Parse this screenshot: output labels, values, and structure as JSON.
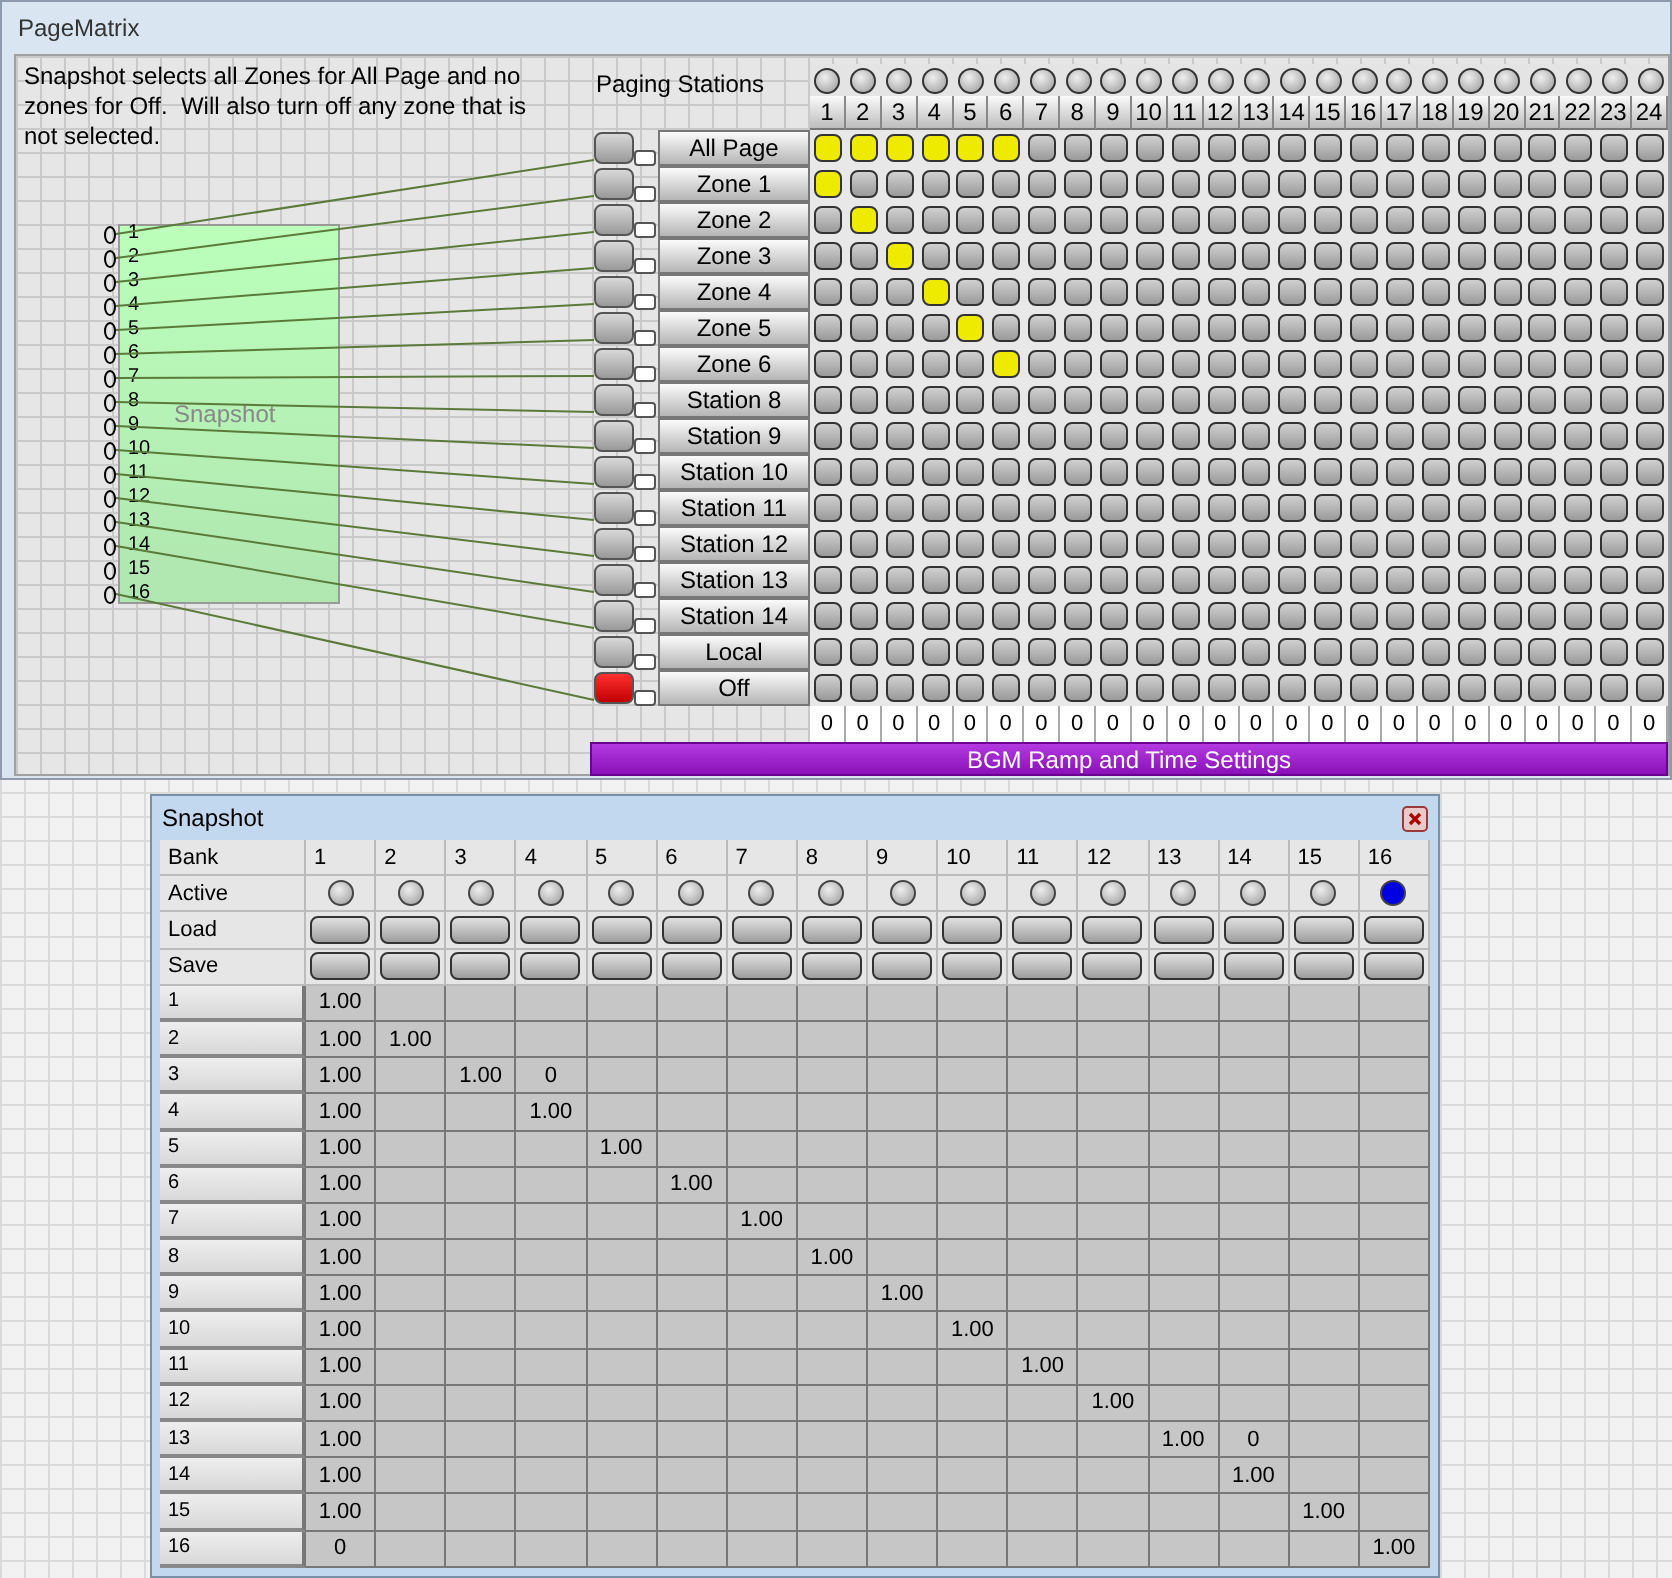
{
  "window": {
    "title": "PageMatrix"
  },
  "description": "Snapshot selects all Zones for All Page and no zones for Off.  Will also turn off any zone that is not selected.",
  "snapshot_block": {
    "label": "Snapshot",
    "pins": [
      {
        "label": "1",
        "connected": true
      },
      {
        "label": "2",
        "connected": true
      },
      {
        "label": "3",
        "connected": true
      },
      {
        "label": "4",
        "connected": true
      },
      {
        "label": "5",
        "connected": true
      },
      {
        "label": "6",
        "connected": true
      },
      {
        "label": "7",
        "connected": true
      },
      {
        "label": "8",
        "connected": true
      },
      {
        "label": "9",
        "connected": true
      },
      {
        "label": "10",
        "connected": true
      },
      {
        "label": "11",
        "connected": true
      },
      {
        "label": "12",
        "connected": true
      },
      {
        "label": "13",
        "connected": true
      },
      {
        "label": "14",
        "connected": true
      },
      {
        "label": "15",
        "connected": false
      },
      {
        "label": "16",
        "connected": true
      }
    ]
  },
  "matrix": {
    "title": "Paging Stations",
    "columns": [
      {
        "label": "1",
        "lit": false,
        "value": "0"
      },
      {
        "label": "2",
        "lit": false,
        "value": "0"
      },
      {
        "label": "3",
        "lit": false,
        "value": "0"
      },
      {
        "label": "4",
        "lit": false,
        "value": "0"
      },
      {
        "label": "5",
        "lit": false,
        "value": "0"
      },
      {
        "label": "6",
        "lit": false,
        "value": "0"
      },
      {
        "label": "7",
        "lit": false,
        "value": "0"
      },
      {
        "label": "8",
        "lit": false,
        "value": "0"
      },
      {
        "label": "9",
        "lit": false,
        "value": "0"
      },
      {
        "label": "10",
        "lit": false,
        "value": "0"
      },
      {
        "label": "11",
        "lit": false,
        "value": "0"
      },
      {
        "label": "12",
        "lit": false,
        "value": "0"
      },
      {
        "label": "13",
        "lit": false,
        "value": "0"
      },
      {
        "label": "14",
        "lit": false,
        "value": "0"
      },
      {
        "label": "15",
        "lit": false,
        "value": "0"
      },
      {
        "label": "16",
        "lit": false,
        "value": "0"
      },
      {
        "label": "17",
        "lit": false,
        "value": "0"
      },
      {
        "label": "18",
        "lit": false,
        "value": "0"
      },
      {
        "label": "19",
        "lit": false,
        "value": "0"
      },
      {
        "label": "20",
        "lit": false,
        "value": "0"
      },
      {
        "label": "21",
        "lit": false,
        "value": "0"
      },
      {
        "label": "22",
        "lit": false,
        "value": "0"
      },
      {
        "label": "23",
        "lit": false,
        "value": "0"
      },
      {
        "label": "24",
        "lit": false,
        "value": "0"
      }
    ],
    "stations": [
      {
        "label": "All Page",
        "active": false,
        "crosspoints": [
          true,
          true,
          true,
          true,
          true,
          true,
          false,
          false,
          false,
          false,
          false,
          false,
          false,
          false,
          false,
          false,
          false,
          false,
          false,
          false,
          false,
          false,
          false,
          false
        ]
      },
      {
        "label": "Zone 1",
        "active": false,
        "crosspoints": [
          true,
          false,
          false,
          false,
          false,
          false,
          false,
          false,
          false,
          false,
          false,
          false,
          false,
          false,
          false,
          false,
          false,
          false,
          false,
          false,
          false,
          false,
          false,
          false
        ]
      },
      {
        "label": "Zone 2",
        "active": false,
        "crosspoints": [
          false,
          true,
          false,
          false,
          false,
          false,
          false,
          false,
          false,
          false,
          false,
          false,
          false,
          false,
          false,
          false,
          false,
          false,
          false,
          false,
          false,
          false,
          false,
          false
        ]
      },
      {
        "label": "Zone 3",
        "active": false,
        "crosspoints": [
          false,
          false,
          true,
          false,
          false,
          false,
          false,
          false,
          false,
          false,
          false,
          false,
          false,
          false,
          false,
          false,
          false,
          false,
          false,
          false,
          false,
          false,
          false,
          false
        ]
      },
      {
        "label": "Zone 4",
        "active": false,
        "crosspoints": [
          false,
          false,
          false,
          true,
          false,
          false,
          false,
          false,
          false,
          false,
          false,
          false,
          false,
          false,
          false,
          false,
          false,
          false,
          false,
          false,
          false,
          false,
          false,
          false
        ]
      },
      {
        "label": "Zone 5",
        "active": false,
        "crosspoints": [
          false,
          false,
          false,
          false,
          true,
          false,
          false,
          false,
          false,
          false,
          false,
          false,
          false,
          false,
          false,
          false,
          false,
          false,
          false,
          false,
          false,
          false,
          false,
          false
        ]
      },
      {
        "label": "Zone 6",
        "active": false,
        "crosspoints": [
          false,
          false,
          false,
          false,
          false,
          true,
          false,
          false,
          false,
          false,
          false,
          false,
          false,
          false,
          false,
          false,
          false,
          false,
          false,
          false,
          false,
          false,
          false,
          false
        ]
      },
      {
        "label": "Station 8",
        "active": false,
        "crosspoints": [
          false,
          false,
          false,
          false,
          false,
          false,
          false,
          false,
          false,
          false,
          false,
          false,
          false,
          false,
          false,
          false,
          false,
          false,
          false,
          false,
          false,
          false,
          false,
          false
        ]
      },
      {
        "label": "Station 9",
        "active": false,
        "crosspoints": [
          false,
          false,
          false,
          false,
          false,
          false,
          false,
          false,
          false,
          false,
          false,
          false,
          false,
          false,
          false,
          false,
          false,
          false,
          false,
          false,
          false,
          false,
          false,
          false
        ]
      },
      {
        "label": "Station 10",
        "active": false,
        "crosspoints": [
          false,
          false,
          false,
          false,
          false,
          false,
          false,
          false,
          false,
          false,
          false,
          false,
          false,
          false,
          false,
          false,
          false,
          false,
          false,
          false,
          false,
          false,
          false,
          false
        ]
      },
      {
        "label": "Station 11",
        "active": false,
        "crosspoints": [
          false,
          false,
          false,
          false,
          false,
          false,
          false,
          false,
          false,
          false,
          false,
          false,
          false,
          false,
          false,
          false,
          false,
          false,
          false,
          false,
          false,
          false,
          false,
          false
        ]
      },
      {
        "label": "Station 12",
        "active": false,
        "crosspoints": [
          false,
          false,
          false,
          false,
          false,
          false,
          false,
          false,
          false,
          false,
          false,
          false,
          false,
          false,
          false,
          false,
          false,
          false,
          false,
          false,
          false,
          false,
          false,
          false
        ]
      },
      {
        "label": "Station 13",
        "active": false,
        "crosspoints": [
          false,
          false,
          false,
          false,
          false,
          false,
          false,
          false,
          false,
          false,
          false,
          false,
          false,
          false,
          false,
          false,
          false,
          false,
          false,
          false,
          false,
          false,
          false,
          false
        ]
      },
      {
        "label": "Station 14",
        "active": false,
        "crosspoints": [
          false,
          false,
          false,
          false,
          false,
          false,
          false,
          false,
          false,
          false,
          false,
          false,
          false,
          false,
          false,
          false,
          false,
          false,
          false,
          false,
          false,
          false,
          false,
          false
        ]
      },
      {
        "label": "Local",
        "active": false,
        "crosspoints": [
          false,
          false,
          false,
          false,
          false,
          false,
          false,
          false,
          false,
          false,
          false,
          false,
          false,
          false,
          false,
          false,
          false,
          false,
          false,
          false,
          false,
          false,
          false,
          false
        ]
      },
      {
        "label": "Off",
        "active": true,
        "crosspoints": [
          false,
          false,
          false,
          false,
          false,
          false,
          false,
          false,
          false,
          false,
          false,
          false,
          false,
          false,
          false,
          false,
          false,
          false,
          false,
          false,
          false,
          false,
          false,
          false
        ]
      }
    ],
    "bgm_button": "BGM Ramp and Time Settings"
  },
  "snapshot_window": {
    "title": "Snapshot",
    "labels": {
      "bank": "Bank",
      "active": "Active",
      "load": "Load",
      "save": "Save"
    },
    "banks": [
      {
        "label": "1",
        "active": false
      },
      {
        "label": "2",
        "active": false
      },
      {
        "label": "3",
        "active": false
      },
      {
        "label": "4",
        "active": false
      },
      {
        "label": "5",
        "active": false
      },
      {
        "label": "6",
        "active": false
      },
      {
        "label": "7",
        "active": false
      },
      {
        "label": "8",
        "active": false
      },
      {
        "label": "9",
        "active": false
      },
      {
        "label": "10",
        "active": false
      },
      {
        "label": "11",
        "active": false
      },
      {
        "label": "12",
        "active": false
      },
      {
        "label": "13",
        "active": false
      },
      {
        "label": "14",
        "active": false
      },
      {
        "label": "15",
        "active": false
      },
      {
        "label": "16",
        "active": true
      }
    ],
    "rows": [
      {
        "label": "1",
        "cells": [
          "1.00",
          null,
          null,
          null,
          null,
          null,
          null,
          null,
          null,
          null,
          null,
          null,
          null,
          null,
          null,
          null
        ]
      },
      {
        "label": "2",
        "cells": [
          "1.00",
          "1.00",
          null,
          null,
          null,
          null,
          null,
          null,
          null,
          null,
          null,
          null,
          null,
          null,
          null,
          null
        ]
      },
      {
        "label": "3",
        "cells": [
          "1.00",
          null,
          "1.00",
          "0",
          null,
          null,
          null,
          null,
          null,
          null,
          null,
          null,
          null,
          null,
          null,
          null
        ]
      },
      {
        "label": "4",
        "cells": [
          "1.00",
          null,
          null,
          "1.00",
          null,
          null,
          null,
          null,
          null,
          null,
          null,
          null,
          null,
          null,
          null,
          null
        ]
      },
      {
        "label": "5",
        "cells": [
          "1.00",
          null,
          null,
          null,
          "1.00",
          null,
          null,
          null,
          null,
          null,
          null,
          null,
          null,
          null,
          null,
          null
        ]
      },
      {
        "label": "6",
        "cells": [
          "1.00",
          null,
          null,
          null,
          null,
          "1.00",
          null,
          null,
          null,
          null,
          null,
          null,
          null,
          null,
          null,
          null
        ]
      },
      {
        "label": "7",
        "cells": [
          "1.00",
          null,
          null,
          null,
          null,
          null,
          "1.00",
          null,
          null,
          null,
          null,
          null,
          null,
          null,
          null,
          null
        ]
      },
      {
        "label": "8",
        "cells": [
          "1.00",
          null,
          null,
          null,
          null,
          null,
          null,
          "1.00",
          null,
          null,
          null,
          null,
          null,
          null,
          null,
          null
        ]
      },
      {
        "label": "9",
        "cells": [
          "1.00",
          null,
          null,
          null,
          null,
          null,
          null,
          null,
          "1.00",
          null,
          null,
          null,
          null,
          null,
          null,
          null
        ]
      },
      {
        "label": "10",
        "cells": [
          "1.00",
          null,
          null,
          null,
          null,
          null,
          null,
          null,
          null,
          "1.00",
          null,
          null,
          null,
          null,
          null,
          null
        ]
      },
      {
        "label": "11",
        "cells": [
          "1.00",
          null,
          null,
          null,
          null,
          null,
          null,
          null,
          null,
          null,
          "1.00",
          null,
          null,
          null,
          null,
          null
        ]
      },
      {
        "label": "12",
        "cells": [
          "1.00",
          null,
          null,
          null,
          null,
          null,
          null,
          null,
          null,
          null,
          null,
          "1.00",
          null,
          null,
          null,
          null
        ]
      },
      {
        "label": "13",
        "cells": [
          "1.00",
          null,
          null,
          null,
          null,
          null,
          null,
          null,
          null,
          null,
          null,
          null,
          "1.00",
          "0",
          null,
          null
        ]
      },
      {
        "label": "14",
        "cells": [
          "1.00",
          null,
          null,
          null,
          null,
          null,
          null,
          null,
          null,
          null,
          null,
          null,
          null,
          "1.00",
          null,
          null
        ]
      },
      {
        "label": "15",
        "cells": [
          "1.00",
          null,
          null,
          null,
          null,
          null,
          null,
          null,
          null,
          null,
          null,
          null,
          null,
          null,
          "1.00",
          null
        ]
      },
      {
        "label": "16",
        "cells": [
          "0",
          null,
          null,
          null,
          null,
          null,
          null,
          null,
          null,
          null,
          null,
          null,
          null,
          null,
          null,
          "1.00"
        ]
      }
    ]
  }
}
